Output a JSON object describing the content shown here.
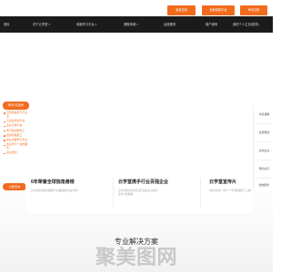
{
  "top_buttons": [
    {
      "label": "免费试用"
    },
    {
      "label": "免费领取平台"
    },
    {
      "label": "申请试用"
    }
  ],
  "nav": {
    "items": [
      {
        "label": "首页"
      },
      {
        "label": "关于云学堂",
        "has_arrow": true
      },
      {
        "label": "电脑学习平台",
        "has_arrow": true
      },
      {
        "label": "课程商城",
        "has_arrow": true
      },
      {
        "label": "运营服务"
      },
      {
        "label": "客户案例"
      },
      {
        "label": "我的个人主页(前排)"
      }
    ]
  },
  "side_menu": {
    "header": "你好,欢迎来",
    "items": [
      "云学堂是学习行业云",
      "云企业培训平台",
      "企业大学平台",
      "学习知识服务工",
      "培训管理员工",
      "企业内部学习平台",
      "企业学习一站式服务",
      "企业培训"
    ],
    "cta": "立即咨询"
  },
  "cards": [
    {
      "title": "6年荣誉全球独角兽榜",
      "desc": "云学堂获得第6年被评\"全球独角兽企业\"榜单"
    },
    {
      "title": "云学堂携手行业百强企业",
      "desc": "云学堂携手众多行业百强企业,共创企业学习新篇章"
    },
    {
      "title": "云学堂宣传片",
      "desc": "全新宣传片《再一个不同的我们》上映"
    }
  ],
  "right_rail": {
    "items": [
      "零基课程",
      "免费赠送",
      "在线企业",
      "预约演示",
      "微信服务"
    ]
  },
  "section": {
    "title": "专业解决方案",
    "watermark": "聚美图网"
  }
}
